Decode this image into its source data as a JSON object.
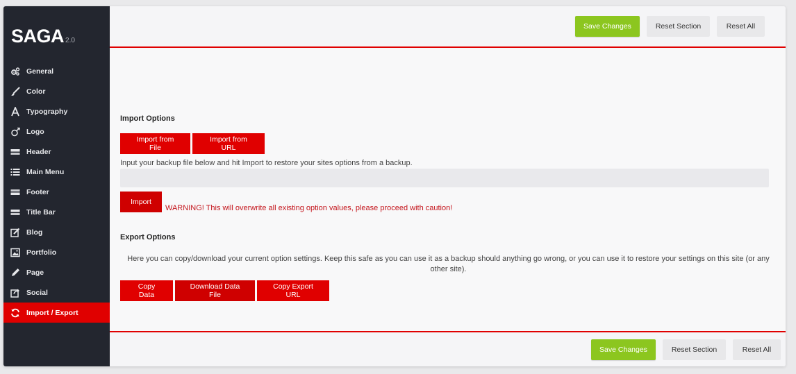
{
  "sidebar": {
    "logo": "SAGA",
    "version": "2.0",
    "items": [
      {
        "label": "General",
        "icon": "gears-icon"
      },
      {
        "label": "Color",
        "icon": "brush-icon"
      },
      {
        "label": "Typography",
        "icon": "font-icon"
      },
      {
        "label": "Logo",
        "icon": "logo-icon"
      },
      {
        "label": "Header",
        "icon": "header-icon"
      },
      {
        "label": "Main Menu",
        "icon": "list-icon"
      },
      {
        "label": "Footer",
        "icon": "footer-icon"
      },
      {
        "label": "Title Bar",
        "icon": "titlebar-icon"
      },
      {
        "label": "Blog",
        "icon": "edit-icon"
      },
      {
        "label": "Portfolio",
        "icon": "image-icon"
      },
      {
        "label": "Page",
        "icon": "pencil-icon"
      },
      {
        "label": "Social",
        "icon": "share-icon"
      },
      {
        "label": "Import / Export",
        "icon": "refresh-icon",
        "active": true
      }
    ]
  },
  "toolbar": {
    "save_label": "Save Changes",
    "reset_section_label": "Reset Section",
    "reset_all_label": "Reset All"
  },
  "import": {
    "title": "Import Options",
    "from_file_label": "Import from File",
    "from_url_label": "Import from URL",
    "description": "Input your backup file below and hit Import to restore your sites options from a backup.",
    "textarea_value": "",
    "import_label": "Import",
    "warning": "WARNING! This will overwrite all existing option values, please proceed with caution!"
  },
  "export": {
    "title": "Export Options",
    "description": "Here you can copy/download your current option settings. Keep this safe as you can use it as a backup should anything go wrong, or you can use it to restore your settings on this site (or any other site).",
    "copy_label": "Copy Data",
    "download_label": "Download Data File",
    "copy_url_label": "Copy Export URL"
  },
  "colors": {
    "accent": "#e00000",
    "save": "#8cc61f",
    "sidebar": "#23262f"
  }
}
